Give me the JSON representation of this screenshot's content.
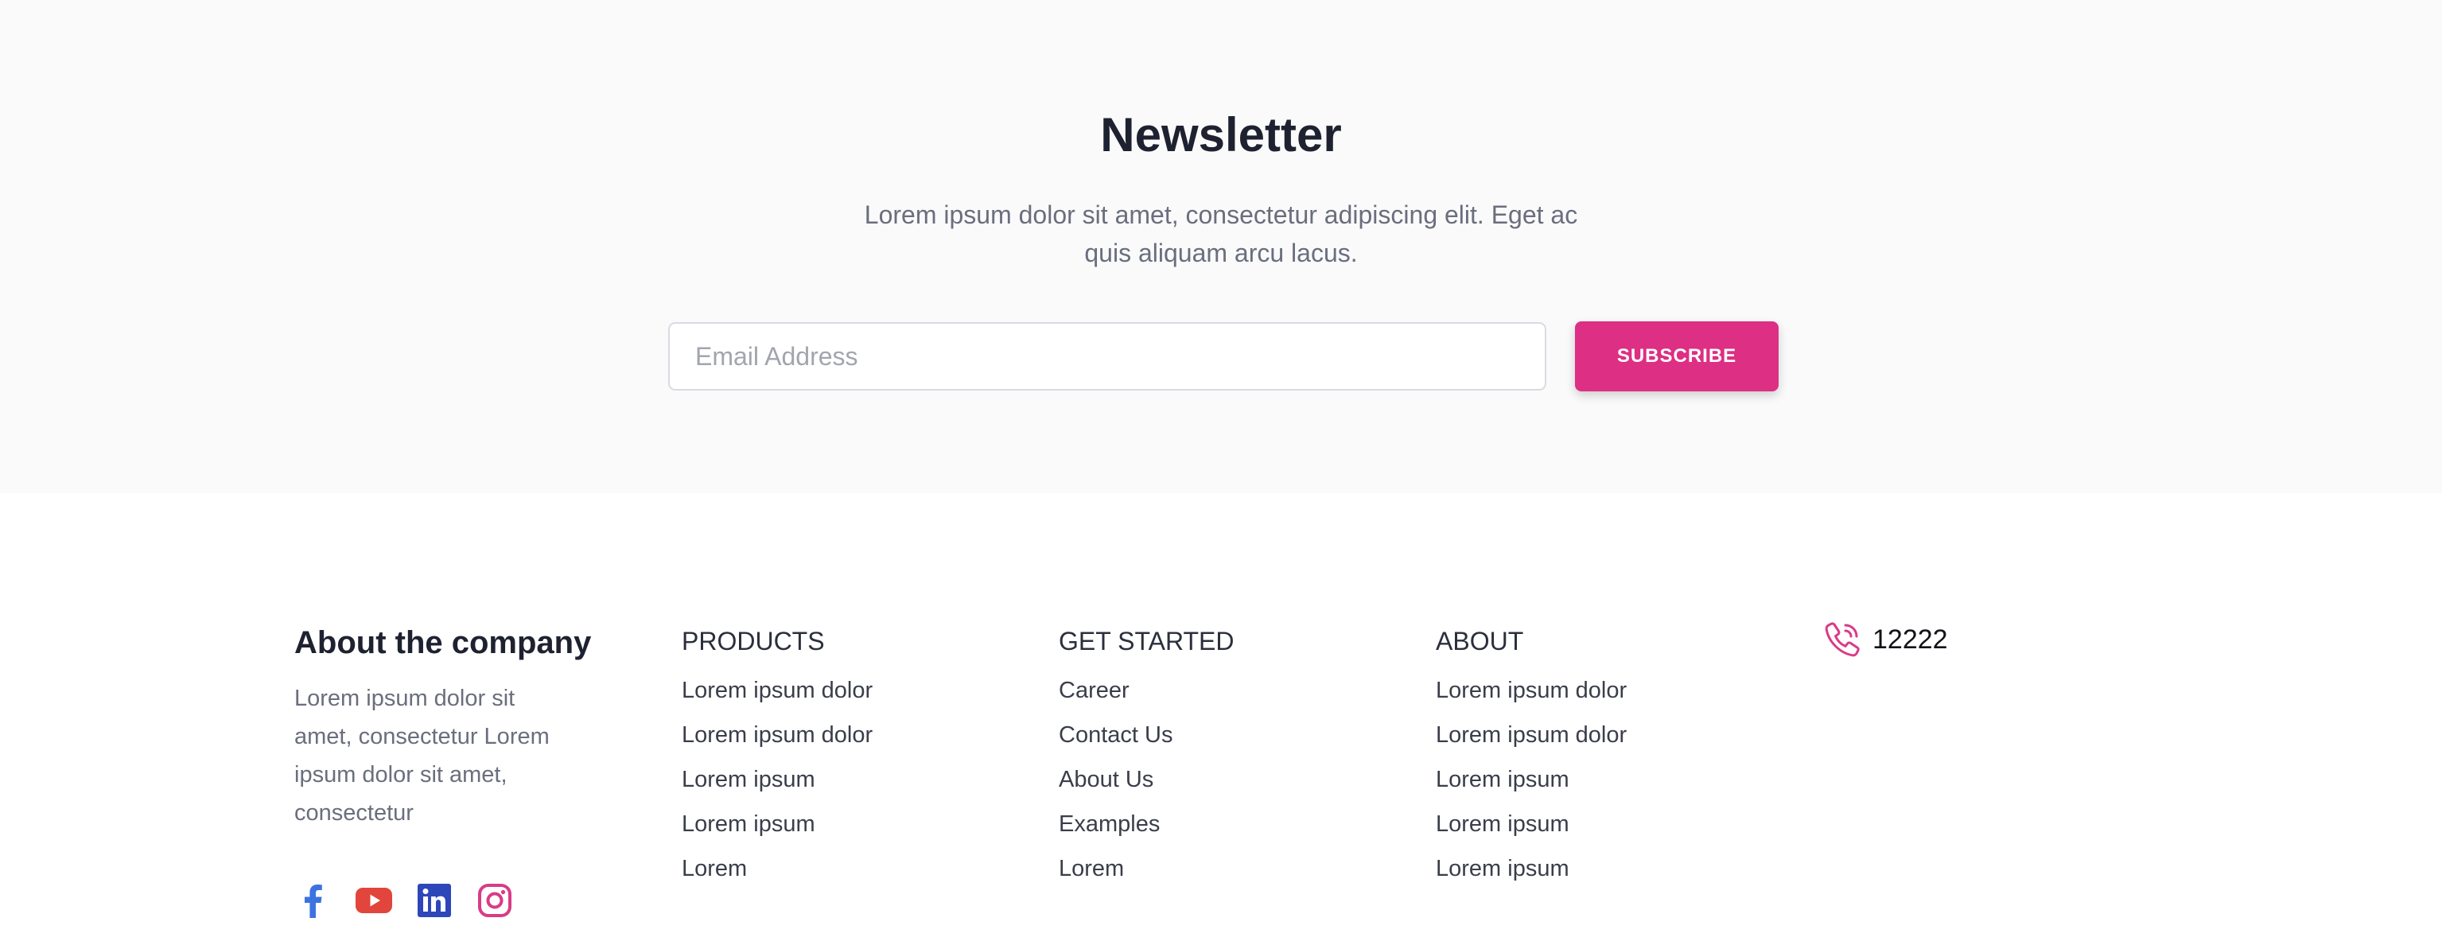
{
  "newsletter": {
    "title": "Newsletter",
    "description": "Lorem ipsum dolor sit amet, consectetur adipiscing elit. Eget ac quis aliquam arcu lacus.",
    "email_placeholder": "Email Address",
    "subscribe_label": "SUBSCRIBE"
  },
  "footer": {
    "about": {
      "title": "About the company",
      "text": "Lorem ipsum dolor sit amet, consectetur Lorem ipsum dolor sit amet, consectetur"
    },
    "social": [
      {
        "icon": "facebook-icon",
        "color": "#3b73e0"
      },
      {
        "icon": "youtube-icon",
        "color": "#e2453c"
      },
      {
        "icon": "linkedin-icon",
        "color": "#2d46b9"
      },
      {
        "icon": "instagram-icon",
        "color": "#d93b86"
      }
    ],
    "columns": [
      {
        "title": "PRODUCTS",
        "items": [
          "Lorem ipsum dolor",
          "Lorem ipsum dolor",
          "Lorem ipsum",
          "Lorem ipsum",
          "Lorem"
        ]
      },
      {
        "title": "GET STARTED",
        "items": [
          "Career",
          "Contact Us",
          "About Us",
          "Examples",
          "Lorem"
        ]
      },
      {
        "title": "ABOUT",
        "items": [
          "Lorem ipsum dolor",
          "Lorem ipsum dolor",
          "Lorem ipsum",
          "Lorem ipsum",
          "Lorem ipsum"
        ]
      }
    ],
    "phone": {
      "icon": "phone-icon",
      "number": "12222"
    }
  },
  "colors": {
    "accent": "#dd2f83",
    "newsletter_bg": "#fafafb",
    "heading": "#1e2230",
    "muted_text": "#6a6e7d"
  }
}
